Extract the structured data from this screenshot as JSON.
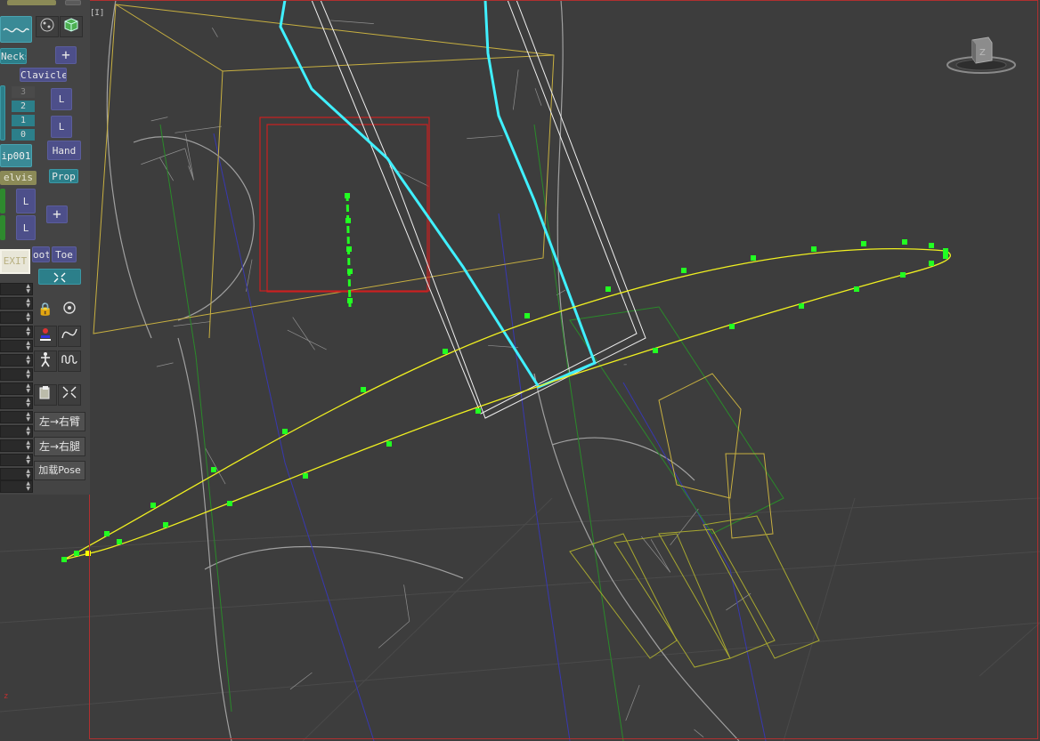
{
  "panel": {
    "necks_label": "Necks",
    "clavicle_label": "Clavicle",
    "hand_label": "Hand",
    "prop_label": "Prop",
    "bip_label": "ip001",
    "pelvis_label": "elvis",
    "foot_label": "oot",
    "toe_label": "Toe",
    "l_label": "L",
    "plus_label": "+",
    "exit_label": "EXIT",
    "counts": [
      "3",
      "2",
      "1",
      "0"
    ],
    "left_to_right_arm": "左→右臂",
    "left_to_right_leg": "左→右腿",
    "load_pose": "加载Pose"
  },
  "viewport": {
    "corner_label": "[I]",
    "axis_label": "z"
  },
  "colors": {
    "panel_bg": "#444444",
    "viewport_bg": "#3d3d3d",
    "wireframe": "#9a9a9a",
    "selection_yellow": "#ffff33",
    "bone_cyan": "#40ffff",
    "handle_green": "#22ff22",
    "bounding_red": "#cc2020"
  },
  "icons": {
    "subdivide": "ribbon-icon",
    "cube": "green-cube-icon",
    "lock": "lock-icon",
    "target": "target-icon",
    "figure": "figure-icon",
    "curve": "curve-icon",
    "walk": "walk-icon",
    "wave": "wave-icon",
    "paste": "paste-icon",
    "collapse": "collapse-icon"
  }
}
